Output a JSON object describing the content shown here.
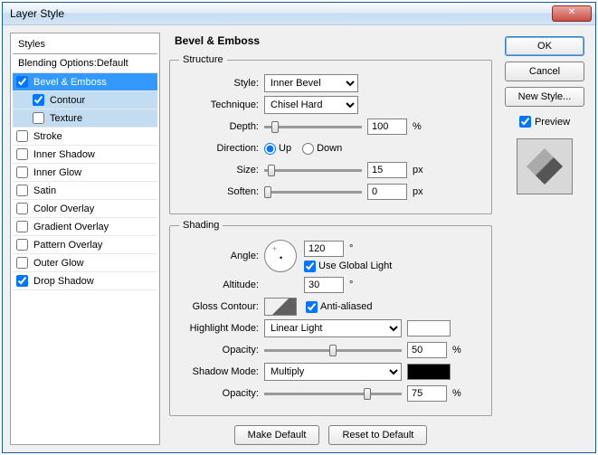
{
  "window": {
    "title": "Layer Style"
  },
  "left": {
    "styles_header": "Styles",
    "blending": "Blending Options:Default",
    "items": [
      {
        "label": "Bevel & Emboss",
        "checked": true,
        "selected": true
      },
      {
        "label": "Contour",
        "checked": true,
        "indent": true,
        "sel_light": true
      },
      {
        "label": "Texture",
        "checked": false,
        "indent": true,
        "sel_light": true
      },
      {
        "label": "Stroke",
        "checked": false
      },
      {
        "label": "Inner Shadow",
        "checked": false
      },
      {
        "label": "Inner Glow",
        "checked": false
      },
      {
        "label": "Satin",
        "checked": false
      },
      {
        "label": "Color Overlay",
        "checked": false
      },
      {
        "label": "Gradient Overlay",
        "checked": false
      },
      {
        "label": "Pattern Overlay",
        "checked": false
      },
      {
        "label": "Outer Glow",
        "checked": false
      },
      {
        "label": "Drop Shadow",
        "checked": true
      }
    ]
  },
  "center": {
    "title": "Bevel & Emboss",
    "structure": {
      "legend": "Structure",
      "style_lbl": "Style:",
      "style_val": "Inner Bevel",
      "technique_lbl": "Technique:",
      "technique_val": "Chisel Hard",
      "depth_lbl": "Depth:",
      "depth_val": "100",
      "depth_unit": "%",
      "direction_lbl": "Direction:",
      "up_lbl": "Up",
      "down_lbl": "Down",
      "size_lbl": "Size:",
      "size_val": "15",
      "size_unit": "px",
      "soften_lbl": "Soften:",
      "soften_val": "0",
      "soften_unit": "px"
    },
    "shading": {
      "legend": "Shading",
      "angle_lbl": "Angle:",
      "angle_val": "120",
      "angle_unit": "°",
      "global_lbl": "Use Global Light",
      "altitude_lbl": "Altitude:",
      "altitude_val": "30",
      "altitude_unit": "°",
      "gloss_lbl": "Gloss Contour:",
      "aa_lbl": "Anti-aliased",
      "hmode_lbl": "Highlight Mode:",
      "hmode_val": "Linear Light",
      "hcolor": "#ffffff",
      "hop_lbl": "Opacity:",
      "hop_val": "50",
      "hop_unit": "%",
      "smode_lbl": "Shadow Mode:",
      "smode_val": "Multiply",
      "scolor": "#000000",
      "sop_lbl": "Opacity:",
      "sop_val": "75",
      "sop_unit": "%"
    },
    "make_default": "Make Default",
    "reset_default": "Reset to Default"
  },
  "right": {
    "ok": "OK",
    "cancel": "Cancel",
    "new_style": "New Style...",
    "preview_lbl": "Preview"
  }
}
